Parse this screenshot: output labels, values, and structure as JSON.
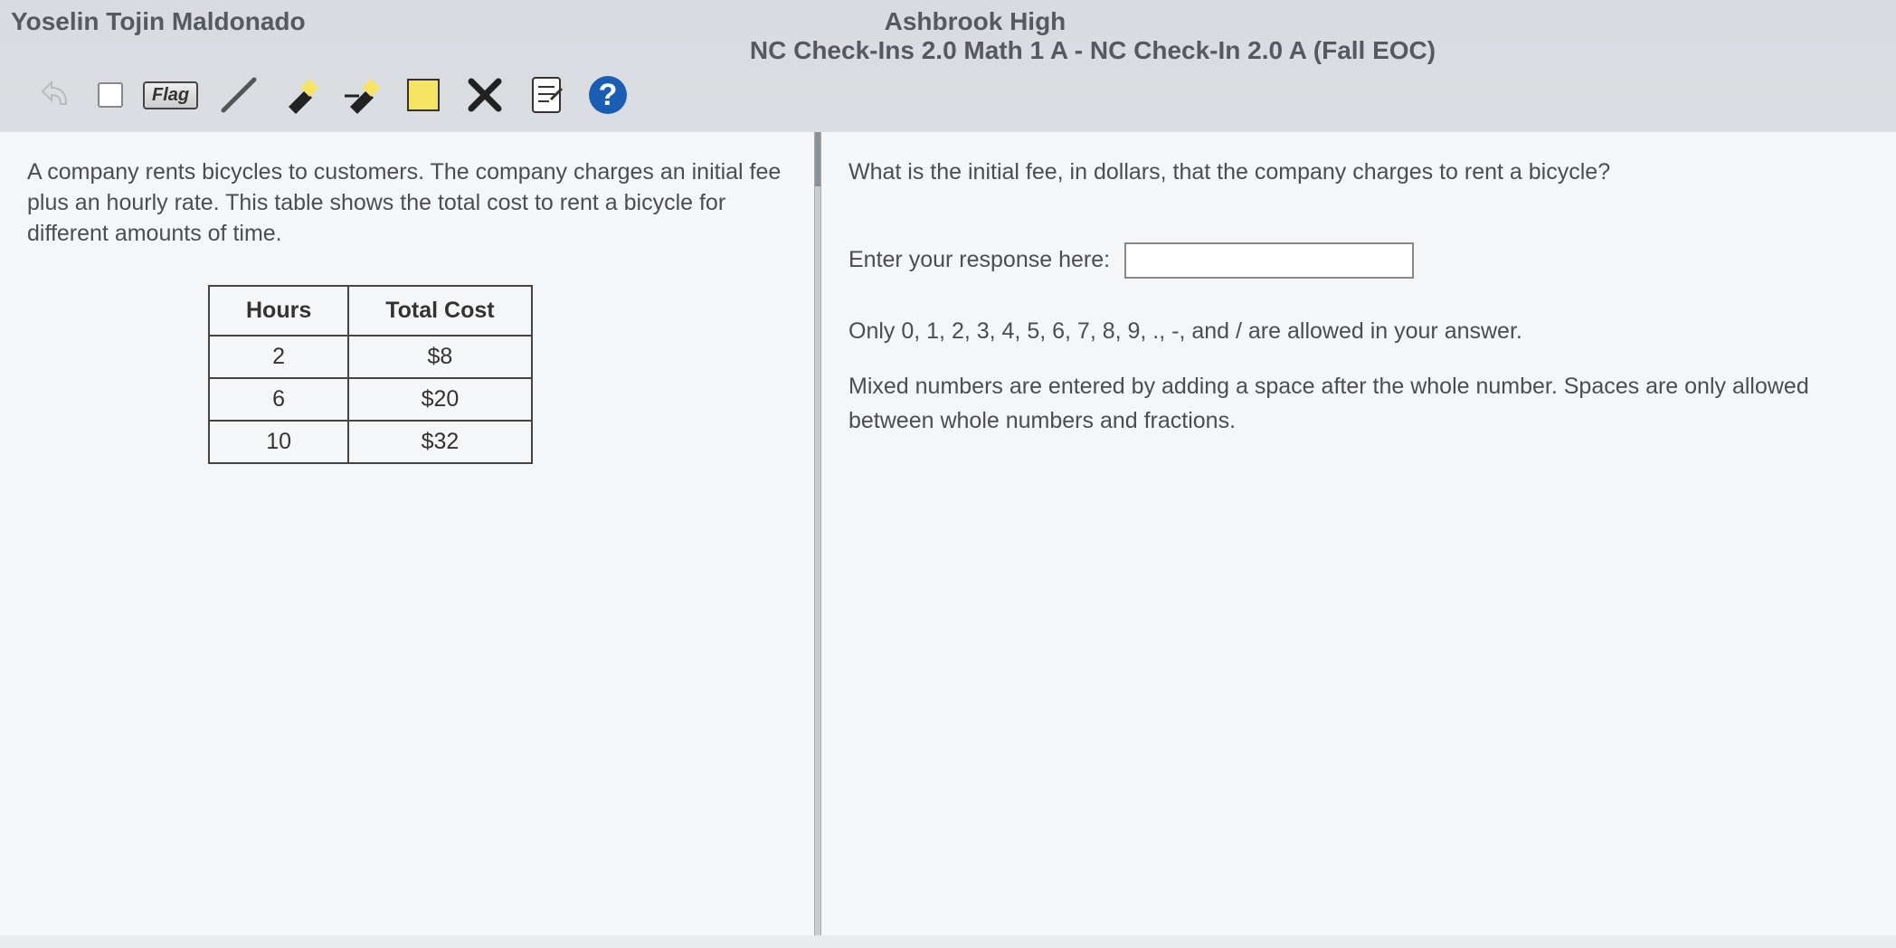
{
  "header": {
    "student": "Yoselin Tojin Maldonado",
    "school": "Ashbrook High",
    "assessment": "NC Check-Ins 2.0 Math 1 A - NC Check-In 2.0 A (Fall EOC)"
  },
  "toolbar": {
    "flag_label": "Flag"
  },
  "left": {
    "prompt": "A company rents bicycles to customers. The company charges an initial fee plus an hourly rate. This table shows the total cost to rent a bicycle for different amounts of time.",
    "table": {
      "headers": [
        "Hours",
        "Total Cost"
      ],
      "rows": [
        [
          "2",
          "$8"
        ],
        [
          "6",
          "$20"
        ],
        [
          "10",
          "$32"
        ]
      ]
    }
  },
  "right": {
    "question": "What is the initial fee, in dollars, that the company charges to rent a bicycle?",
    "response_label": "Enter your response here:",
    "response_value": "",
    "hint1": "Only 0, 1, 2, 3, 4, 5, 6, 7, 8, 9, ., -, and / are allowed in your answer.",
    "hint2": "Mixed numbers are entered by adding a space after the whole number. Spaces are only allowed between whole numbers and fractions."
  }
}
